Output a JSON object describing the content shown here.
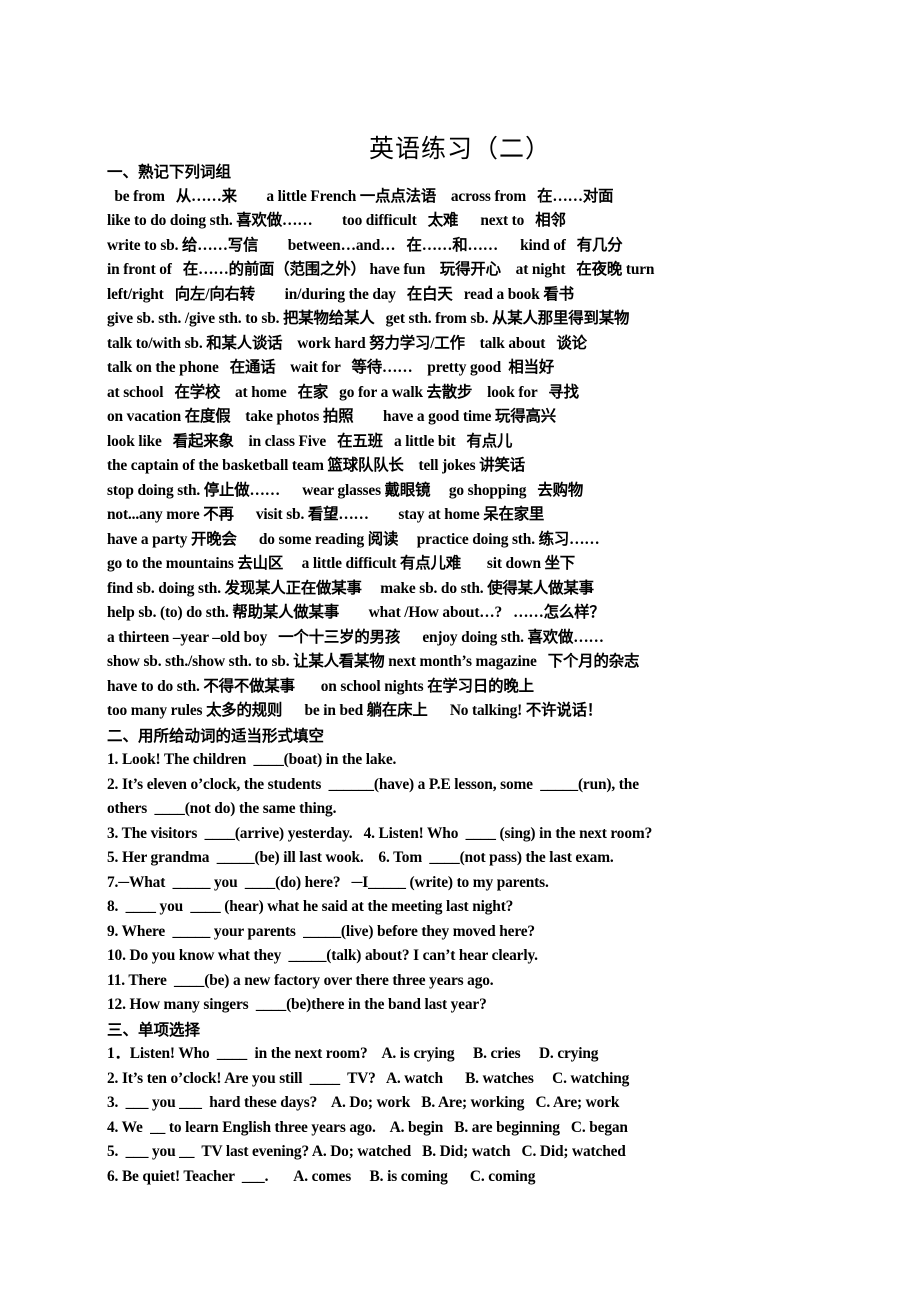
{
  "document": {
    "title": "英语练习（二）"
  },
  "sections": [
    {
      "id": "section-one",
      "heading": "一、熟记下列词组",
      "lines": [
        "  be from   从……来        a little French 一点点法语    across from   在……对面",
        "like to do doing sth. 喜欢做……        too difficult   太难      next to   相邻",
        "write to sb. 给……写信        between…and…   在……和……      kind of   有几分",
        "in front of   在……的前面（范围之外） have fun    玩得开心    at night   在夜晚 turn",
        "left/right   向左/向右转        in/during the day   在白天   read a book 看书",
        "give sb. sth. /give sth. to sb. 把某物给某人   get sth. from sb. 从某人那里得到某物",
        "talk to/with sb. 和某人谈话    work hard 努力学习/工作    talk about   谈论",
        "talk on the phone   在通话    wait for   等待……    pretty good  相当好",
        "at school   在学校    at home   在家   go for a walk 去散步    look for   寻找",
        "on vacation 在度假    take photos 拍照        have a good time 玩得高兴",
        "look like   看起来象    in class Five   在五班   a little bit   有点儿",
        "the captain of the basketball team 篮球队队长    tell jokes 讲笑话",
        "stop doing sth. 停止做……      wear glasses 戴眼镜     go shopping   去购物",
        "not...any more 不再      visit sb. 看望……        stay at home 呆在家里",
        "have a party 开晚会      do some reading 阅读     practice doing sth. 练习……",
        "go to the mountains 去山区     a little difficult 有点儿难       sit down 坐下",
        "find sb. doing sth. 发现某人正在做某事     make sb. do sth. 使得某人做某事",
        "help sb. (to) do sth. 帮助某人做某事        what /How about…?   ……怎么样？",
        "a thirteen –year –old boy   一个十三岁的男孩      enjoy doing sth. 喜欢做……",
        "show sb. sth./show sth. to sb. 让某人看某物 next month’s magazine   下个月的杂志",
        "have to do sth. 不得不做某事       on school nights 在学习日的晚上",
        "too many rules 太多的规则      be in bed 躺在床上      No talking! 不许说话！"
      ]
    },
    {
      "id": "section-two",
      "heading": "二、用所给动词的适当形式填空",
      "lines": [
        "1. Look! The children  ____(boat) in the lake.",
        "2. It’s eleven o’clock, the students  ______(have) a P.E lesson, some  _____(run), the",
        "others  ____(not do) the same thing.",
        "3. The visitors  ____(arrive) yesterday.   4. Listen! Who  ____ (sing) in the next room?",
        "5. Her grandma  _____(be) ill last wook.    6. Tom  ____(not pass) the last exam.",
        "7.─What  _____ you  ____(do) here?   ─I_____ (write) to my parents.",
        "8.  ____ you  ____ (hear) what he said at the meeting last night?",
        "9. Where  _____ your parents  _____(live) before they moved here?",
        "10. Do you know what they  _____(talk) about? I can’t hear clearly.",
        "11. There  ____(be) a new factory over there three years ago.",
        "12. How many singers  ____(be)there in the band last year?"
      ]
    },
    {
      "id": "section-three",
      "heading": "三、单项选择",
      "lines": [
        "1．Listen! Who  ____  in the next room?    A. is crying     B. cries     D. crying",
        "2. It’s ten o’clock! Are you still  ____  TV?   A. watch      B. watches     C. watching",
        "3.  ___ you ___  hard these days?    A. Do; work   B. Are; working   C. Are; work",
        "4. We  __ to learn English three years ago.    A. begin   B. are beginning   C. began",
        "5.  ___ you __  TV last evening? A. Do; watched   B. Did; watch   C. Did; watched",
        "6. Be quiet! Teacher  ___.       A. comes     B. is coming      C. coming"
      ]
    }
  ]
}
